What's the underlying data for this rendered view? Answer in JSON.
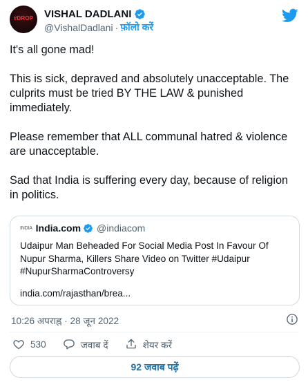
{
  "author": {
    "name": "VISHAL DADLANI",
    "handle": "@VishalDadlani",
    "follow_label": "फ़ॉलो करें",
    "avatar_text": "#DROP"
  },
  "tweet": {
    "paragraphs": [
      "It's all gone mad!",
      "This is sick, depraved and absolutely unacceptable. The culprits must be tried BY THE LAW & punished immediately.",
      "Please remember that ALL communal hatred & violence are unacceptable.",
      "Sad that India is suffering every day, because of religion in politics."
    ]
  },
  "quote": {
    "logo_text": "INDIA",
    "name": "India.com",
    "handle": "@indiacom",
    "text": "Udaipur Man Beheaded For Social Media Post In Favour Of Nupur Sharma, Killers Share Video on Twitter #Udaipur #NupurSharmaControversy",
    "link": "india.com/rajasthan/brea..."
  },
  "meta": {
    "timestamp": "10:26 अपराह्न · 28 जून 2022"
  },
  "actions": {
    "like_count": "530",
    "reply_label": "जवाब दें",
    "share_label": "शेयर करें"
  },
  "replies_button": "92 जवाब पढ़ें",
  "colors": {
    "accent": "#1d9bf0",
    "replies_text": "#1d6fa5",
    "muted": "#536471",
    "border": "#cfd9de"
  }
}
